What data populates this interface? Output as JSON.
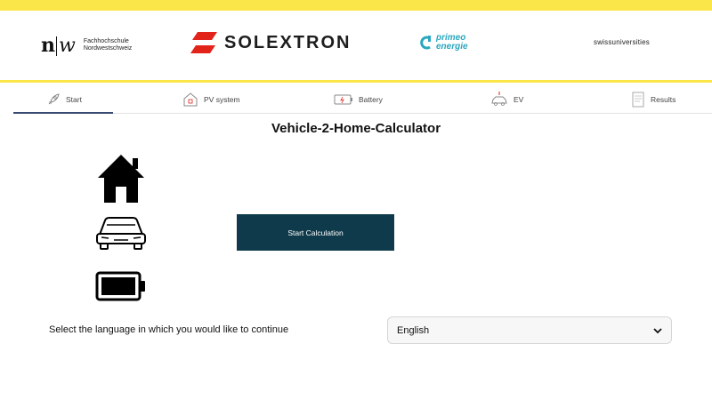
{
  "header": {
    "fhnw_mark_n": "n",
    "fhnw_mark_w": "w",
    "fhnw_line1": "Fachhochschule",
    "fhnw_line2": "Nordwestschweiz",
    "solextron": "SOLEXTRON",
    "primeo_line1": "primeo",
    "primeo_line2": "energie",
    "swissuniversities": "swissuniversities",
    "accent_color": "#fbe64a"
  },
  "tabs": [
    {
      "label": "Start",
      "icon": "rocket-icon",
      "active": true
    },
    {
      "label": "PV system",
      "icon": "house-solar-icon",
      "active": false
    },
    {
      "label": "Battery",
      "icon": "battery-icon",
      "active": false
    },
    {
      "label": "EV",
      "icon": "car-icon",
      "active": false
    },
    {
      "label": "Results",
      "icon": "document-icon",
      "active": false
    }
  ],
  "main": {
    "title": "Vehicle-2-Home-Calculator",
    "start_button": "Start Calculation",
    "button_color": "#0f3a4b",
    "language_label": "Select the language in which you would like to continue",
    "language_value": "English"
  }
}
